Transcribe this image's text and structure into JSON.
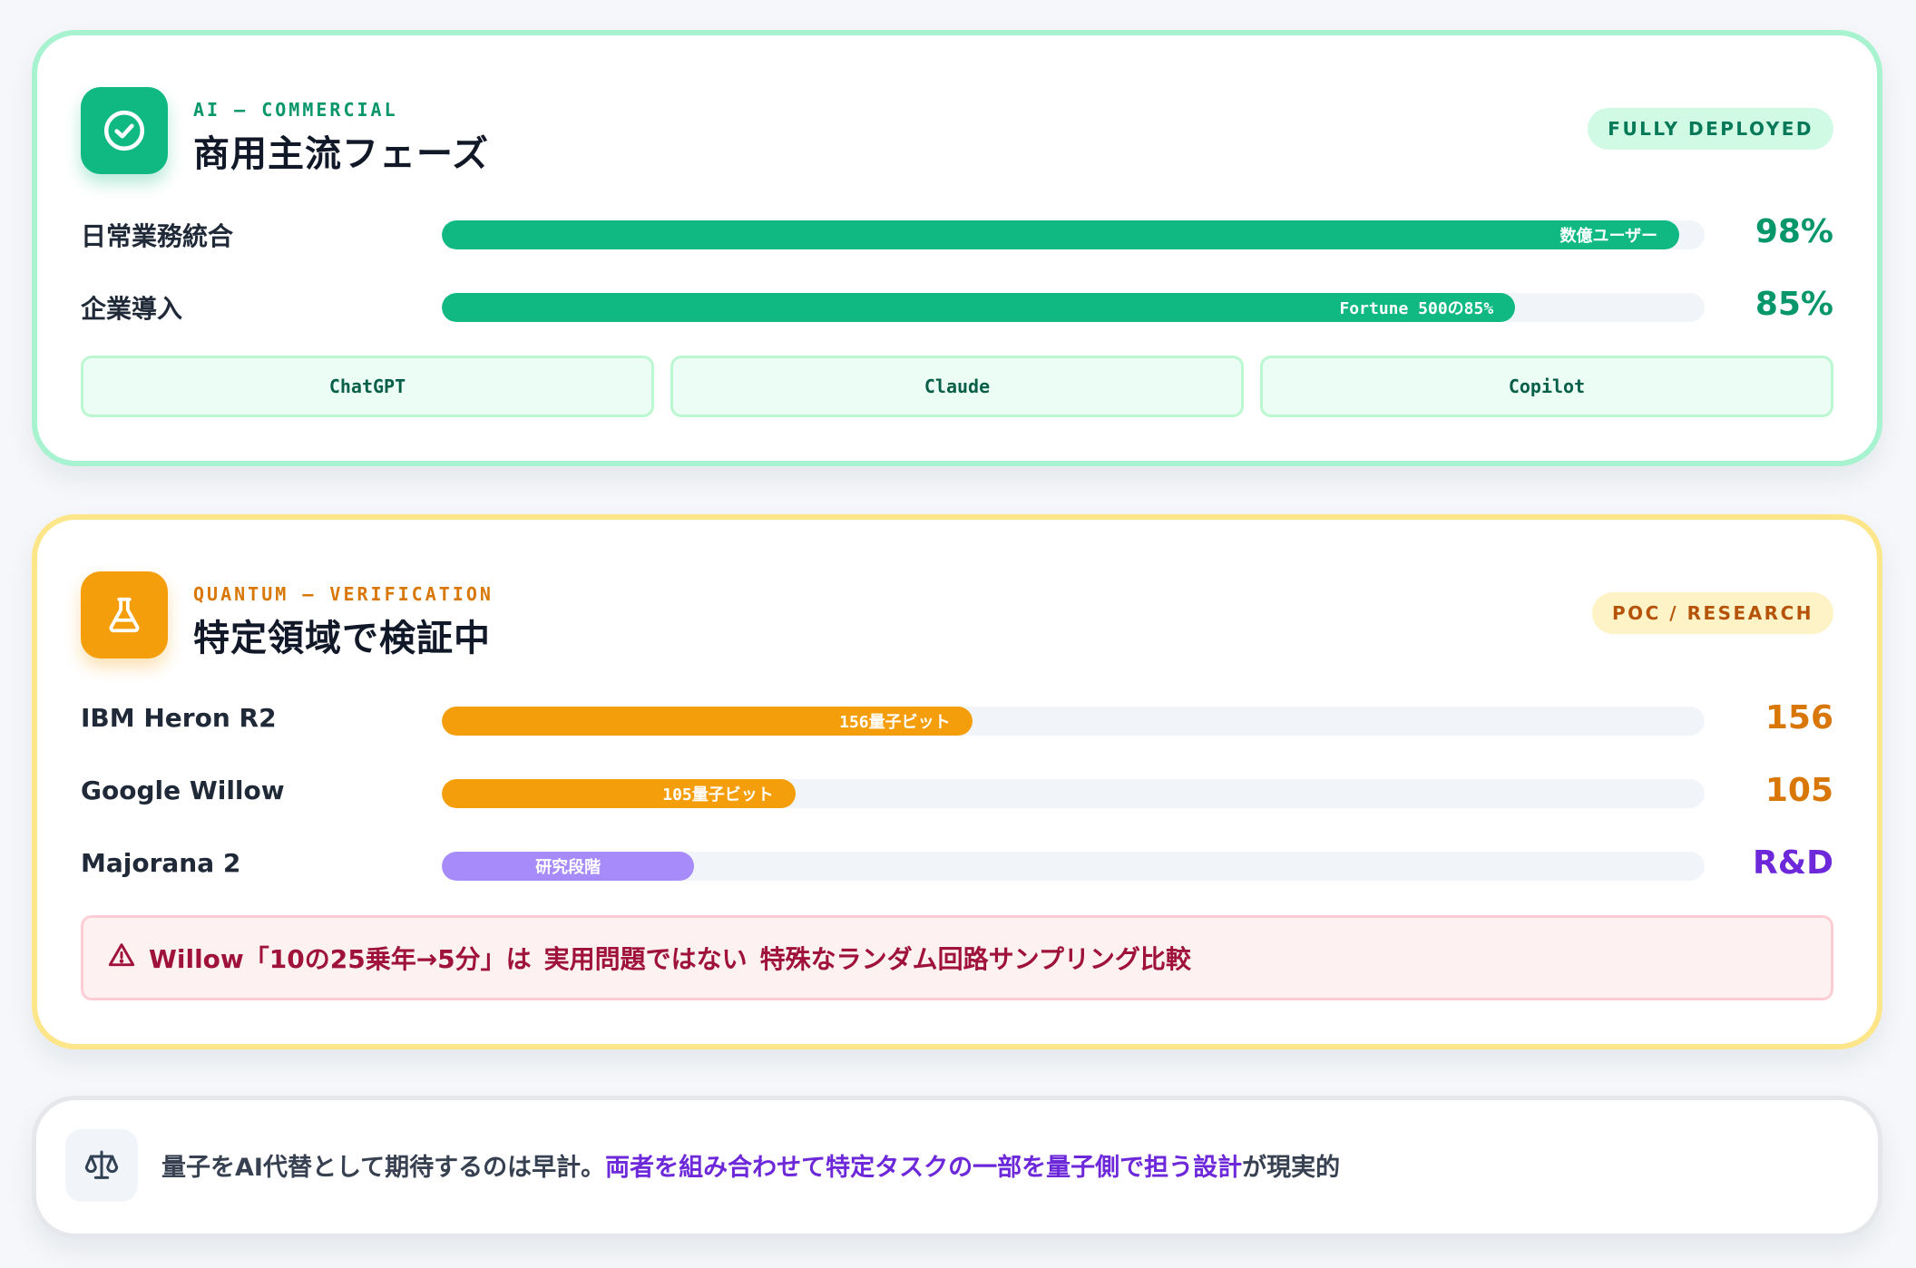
{
  "ai": {
    "eyebrow": "AI — COMMERCIAL",
    "title": "商用主流フェーズ",
    "badge": "FULLY DEPLOYED",
    "icon": "check-circle-icon",
    "color": "#10b981",
    "rows": [
      {
        "label": "日常業務統合",
        "bar_text": "数億ユーザー",
        "value": "98%",
        "fill_percent": 98
      },
      {
        "label": "企業導入",
        "bar_text": "Fortune 500の85%",
        "value": "85%",
        "fill_percent": 85
      }
    ],
    "chips": [
      "ChatGPT",
      "Claude",
      "Copilot"
    ]
  },
  "quantum": {
    "eyebrow": "QUANTUM — VERIFICATION",
    "title": "特定領域で検証中",
    "badge": "POC / RESEARCH",
    "icon": "flask-icon",
    "color": "#f59e0b",
    "rows": [
      {
        "label": "IBM Heron R2",
        "bar_text": "156量子ビット",
        "value": "156",
        "fill_percent": 42,
        "color": "#f59e0b",
        "value_color": "#d97706"
      },
      {
        "label": "Google Willow",
        "bar_text": "105量子ビット",
        "value": "105",
        "fill_percent": 28,
        "color": "#f59e0b",
        "value_color": "#d97706"
      },
      {
        "label": "Majorana 2",
        "bar_text": "研究段階",
        "value": "R&D",
        "fill_percent": 20,
        "color": "#a78bfa",
        "value_color": "#6d28d9"
      }
    ],
    "alert": {
      "icon": "warning-triangle-icon",
      "parts": [
        "Willow「10の25乗年→5分」は",
        "実用問題ではない",
        "特殊なランダム回路サンプリング比較"
      ]
    }
  },
  "note": {
    "icon": "scale-balance-icon",
    "text_before": "量子をAI代替として期待するのは早計。",
    "text_highlight": "両者を組み合わせて特定タスクの一部を量子側で担う設計",
    "text_after": "が現実的"
  }
}
